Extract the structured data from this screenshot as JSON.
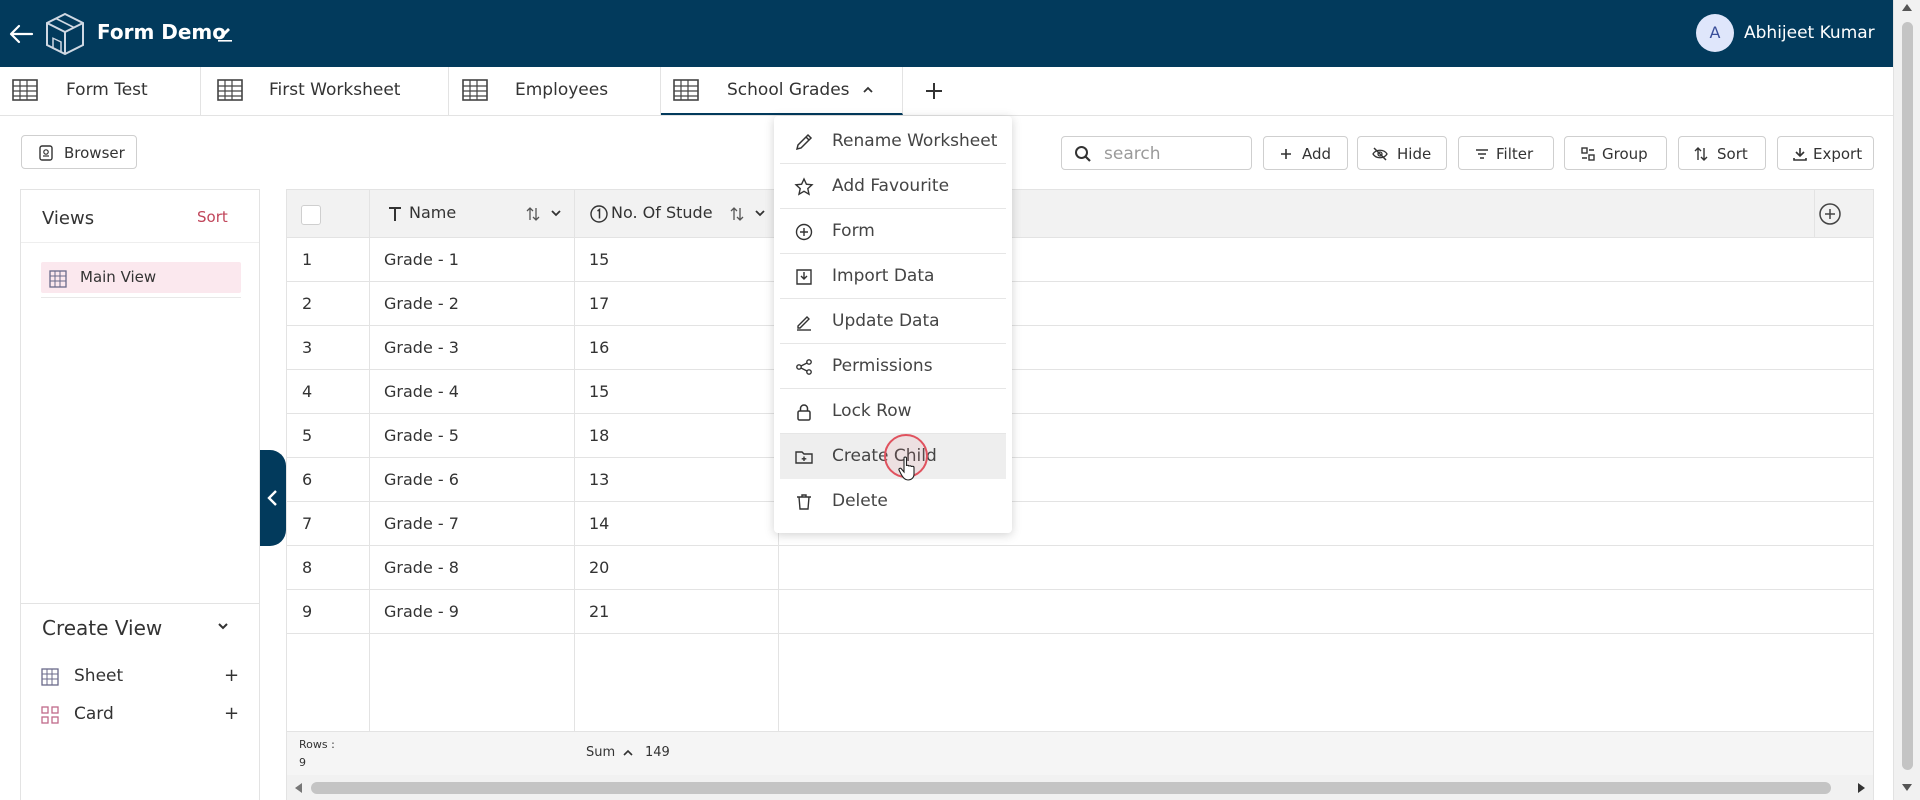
{
  "header": {
    "back_icon": "arrow-left-icon",
    "logo_icon": "cube-logo-icon",
    "app_title": "Form Demo",
    "edit_icon": "pencil-icon",
    "user_initial": "A",
    "user_name": "Abhijeet Kumar"
  },
  "tabs": [
    {
      "label": "Form Test",
      "icon": "table-icon"
    },
    {
      "label": "First Worksheet",
      "icon": "table-icon"
    },
    {
      "label": "Employees",
      "icon": "table-icon"
    },
    {
      "label": "School Grades",
      "icon": "table-icon",
      "active": true
    }
  ],
  "toolbar": {
    "browser_label": "Browser",
    "search_placeholder": "search",
    "add_label": "Add",
    "hide_label": "Hide",
    "filter_label": "Filter",
    "group_label": "Group",
    "sort_label": "Sort",
    "export_label": "Export"
  },
  "views_panel": {
    "title": "Views",
    "sort_label": "Sort",
    "items": [
      {
        "label": "Main View"
      }
    ],
    "create_title": "Create View",
    "create_items": [
      {
        "label": "Sheet",
        "add": "+"
      },
      {
        "label": "Card",
        "add": "+"
      }
    ]
  },
  "grid": {
    "columns": [
      {
        "label": "Name",
        "icon": "text-type-icon"
      },
      {
        "label": "No. Of Stude",
        "icon": "number-type-icon"
      }
    ],
    "rows": [
      {
        "id": "1",
        "name": "Grade - 1",
        "students": "15"
      },
      {
        "id": "2",
        "name": "Grade - 2",
        "students": "17"
      },
      {
        "id": "3",
        "name": "Grade - 3",
        "students": "16"
      },
      {
        "id": "4",
        "name": "Grade - 4",
        "students": "15"
      },
      {
        "id": "5",
        "name": "Grade - 5",
        "students": "18"
      },
      {
        "id": "6",
        "name": "Grade - 6",
        "students": "13"
      },
      {
        "id": "7",
        "name": "Grade - 7",
        "students": "14"
      },
      {
        "id": "8",
        "name": "Grade - 8",
        "students": "20"
      },
      {
        "id": "9",
        "name": "Grade - 9",
        "students": "21"
      }
    ],
    "footer": {
      "rows_label": "Rows :",
      "rows_count": "9",
      "sum_label": "Sum",
      "sum_value": "149"
    }
  },
  "menu": {
    "items": [
      {
        "label": "Rename Worksheet",
        "icon": "pencil-icon"
      },
      {
        "label": "Add Favourite",
        "icon": "star-icon"
      },
      {
        "label": "Form",
        "icon": "plus-circle-icon"
      },
      {
        "label": "Import Data",
        "icon": "import-icon"
      },
      {
        "label": "Update Data",
        "icon": "edit-line-icon"
      },
      {
        "label": "Permissions",
        "icon": "share-icon"
      },
      {
        "label": "Lock Row",
        "icon": "lock-icon"
      },
      {
        "label": "Create Child",
        "icon": "folder-plus-icon",
        "hovered": true
      },
      {
        "label": "Delete",
        "icon": "trash-icon"
      }
    ]
  },
  "colors": {
    "header_bg": "#023a5c",
    "accent_pink": "#c0455a",
    "selected_view_bg": "#fbe8ee"
  }
}
